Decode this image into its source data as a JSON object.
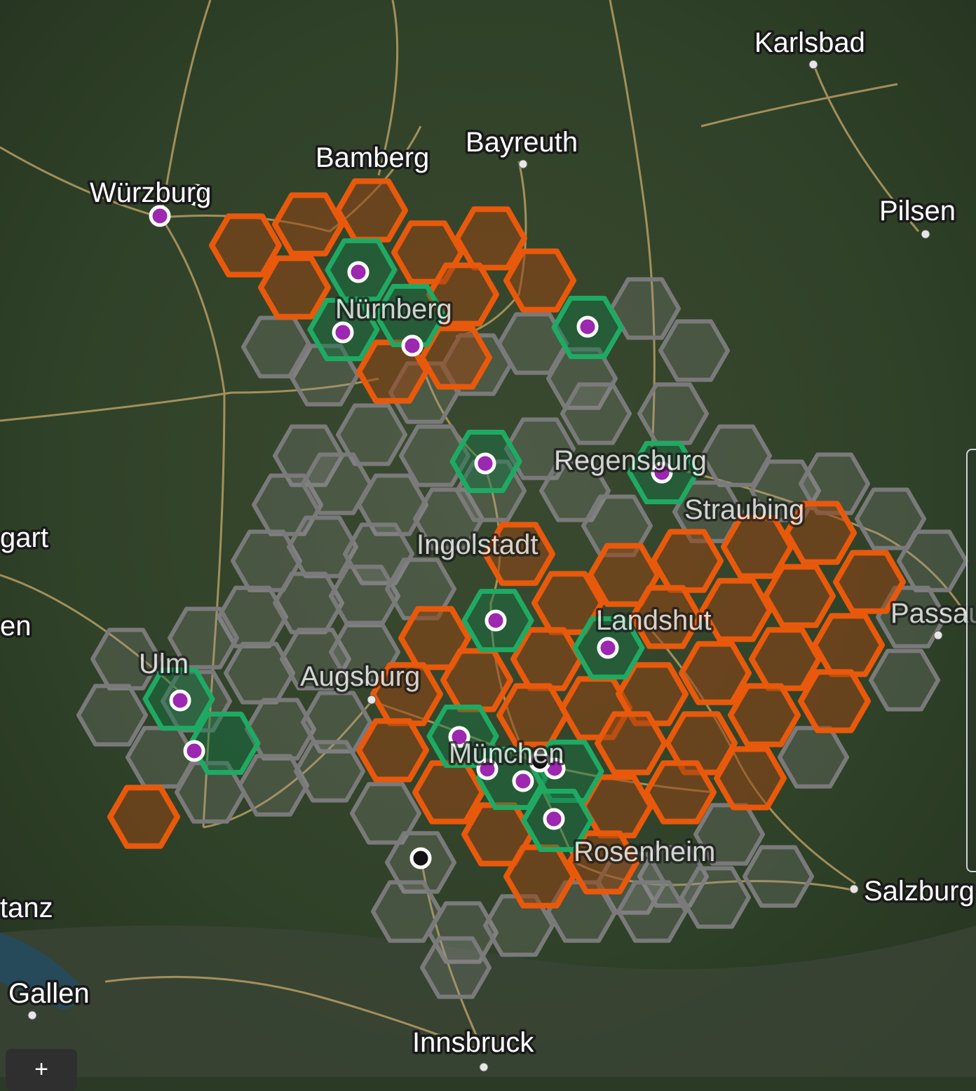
{
  "map": {
    "labels": {
      "karlsbad": "Karlsbad",
      "bayreuth": "Bayreuth",
      "bamberg": "Bamberg",
      "wuerzburg": "Würzburg",
      "pilsen": "Pilsen",
      "nuernberg": "Nürnberg",
      "regensburg": "Regensburg",
      "straubing": "Straubing",
      "ingolstadt": "Ingolstadt",
      "stuttgart": "gart",
      "landshut": "Landshut",
      "passau": "Passau",
      "en": "en",
      "ulm": "Ulm",
      "augsburg": "Augsburg",
      "muenchen": "München",
      "rosenheim": "Rosenheim",
      "salzburg": "Salzburg",
      "konstanz": "tanz",
      "stgallen": "Gallen",
      "innsbruck": "Innsbruck"
    },
    "colors": {
      "orange": "#e8590c",
      "green": "#1faa64",
      "gray": "#7a7a7a",
      "marker_fill": "#9c27b0"
    },
    "zoom_in_label": "+"
  }
}
